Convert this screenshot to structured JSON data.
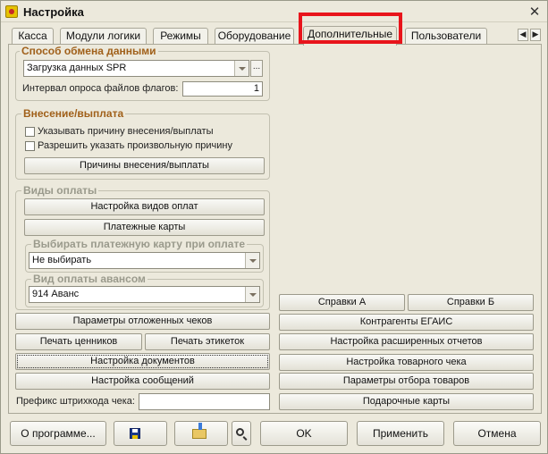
{
  "window": {
    "title": "Настройка",
    "close_glyph": "✕"
  },
  "tabs": [
    {
      "label": "Касса"
    },
    {
      "label": "Модули логики"
    },
    {
      "label": "Режимы"
    },
    {
      "label": "Оборудование"
    },
    {
      "label": "Дополнительные",
      "active": true
    },
    {
      "label": "Пользователи"
    }
  ],
  "tab_scroll": {
    "left": "◀",
    "right": "▶"
  },
  "exchange": {
    "title": "Способ обмена данными",
    "method_value": "Загрузка данных SPR",
    "dots": "...",
    "interval_label": "Интервал опроса файлов флагов:",
    "interval_value": "1"
  },
  "deposit": {
    "title": "Внесение/выплата",
    "chk_reason_label": "Указывать причину внесения/выплаты",
    "chk_any_reason_label": "Разрешить указать произвольную причину",
    "reasons_button": "Причины внесения/выплаты"
  },
  "payment": {
    "title": "Виды оплаты",
    "setup_button": "Настройка видов оплат",
    "cards_button": "Платежные карты",
    "card_group_title": "Выбирать платежную карту при оплате",
    "card_value": "Не выбирать",
    "advance_group_title": "Вид оплаты авансом",
    "advance_value": "914 Аванс"
  },
  "left_buttons": {
    "deferred": "Параметры отложенных чеков",
    "price_tags": "Печать ценников",
    "labels": "Печать этикеток",
    "documents": "Настройка документов",
    "messages": "Настройка сообщений",
    "barcode_prefix_label": "Префикс штрихкода чека:",
    "barcode_prefix_value": ""
  },
  "right_buttons": {
    "ref_a": "Справки А",
    "ref_b": "Справки Б",
    "egais": "Контрагенты ЕГАИС",
    "ext_reports": "Настройка расширенных отчетов",
    "goods_receipt": "Настройка товарного чека",
    "goods_filter": "Параметры отбора товаров",
    "gift_cards": "Подарочные карты"
  },
  "bottom": {
    "about": "О программе...",
    "ok": "OK",
    "apply": "Применить",
    "cancel": "Отмена"
  },
  "colors": {
    "group_title": "#a0601a",
    "highlight": "#e8141b",
    "window_bg": "#ece9dc"
  }
}
